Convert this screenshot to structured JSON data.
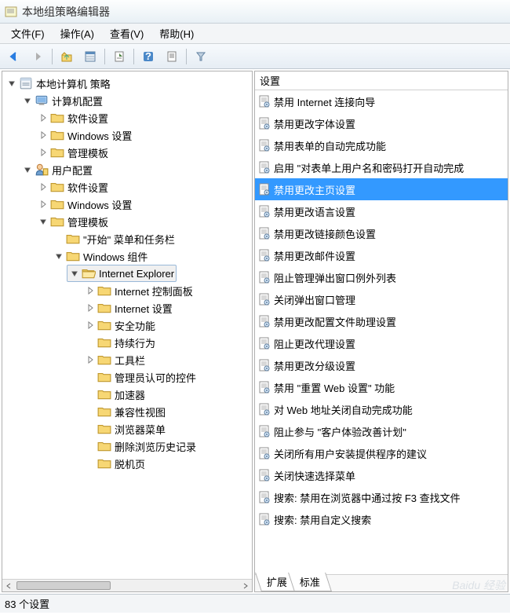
{
  "window": {
    "title": "本地组策略编辑器"
  },
  "menu": [
    {
      "label": "文件(F)"
    },
    {
      "label": "操作(A)"
    },
    {
      "label": "查看(V)"
    },
    {
      "label": "帮助(H)"
    }
  ],
  "toolbar": [
    {
      "name": "back-icon",
      "color": "#2a7de1",
      "disabled": false
    },
    {
      "name": "forward-icon",
      "color": "#a0a0a0",
      "disabled": true
    },
    {
      "name": "sep"
    },
    {
      "name": "up-folder-icon"
    },
    {
      "name": "list-view-icon"
    },
    {
      "name": "sep"
    },
    {
      "name": "export-icon"
    },
    {
      "name": "sep"
    },
    {
      "name": "help-icon"
    },
    {
      "name": "properties-icon"
    },
    {
      "name": "sep"
    },
    {
      "name": "filter-icon"
    }
  ],
  "tree": {
    "root": {
      "icon": "policy",
      "label": "本地计算机 策略",
      "expanded": true,
      "children": [
        {
          "icon": "computer",
          "label": "计算机配置",
          "expanded": true,
          "children": [
            {
              "icon": "folder",
              "label": "软件设置",
              "collapsed": true
            },
            {
              "icon": "folder",
              "label": "Windows 设置",
              "collapsed": true
            },
            {
              "icon": "folder",
              "label": "管理模板",
              "collapsed": true
            }
          ]
        },
        {
          "icon": "user",
          "label": "用户配置",
          "expanded": true,
          "children": [
            {
              "icon": "folder",
              "label": "软件设置",
              "collapsed": true
            },
            {
              "icon": "folder",
              "label": "Windows 设置",
              "collapsed": true
            },
            {
              "icon": "folder",
              "label": "管理模板",
              "expanded": true,
              "children": [
                {
                  "icon": "folder",
                  "label": "\"开始\" 菜单和任务栏",
                  "leaf": true
                },
                {
                  "icon": "folder",
                  "label": "Windows 组件",
                  "expanded": true,
                  "children": [
                    {
                      "icon": "folder-open",
                      "label": "Internet Explorer",
                      "expanded": true,
                      "selected": true,
                      "children": [
                        {
                          "icon": "folder",
                          "label": "Internet 控制面板",
                          "collapsed": true
                        },
                        {
                          "icon": "folder",
                          "label": "Internet 设置",
                          "collapsed": true
                        },
                        {
                          "icon": "folder",
                          "label": "安全功能",
                          "collapsed": true
                        },
                        {
                          "icon": "folder",
                          "label": "持续行为",
                          "leaf": true
                        },
                        {
                          "icon": "folder",
                          "label": "工具栏",
                          "collapsed": true
                        },
                        {
                          "icon": "folder",
                          "label": "管理员认可的控件",
                          "leaf": true
                        },
                        {
                          "icon": "folder",
                          "label": "加速器",
                          "leaf": true
                        },
                        {
                          "icon": "folder",
                          "label": "兼容性视图",
                          "leaf": true
                        },
                        {
                          "icon": "folder",
                          "label": "浏览器菜单",
                          "leaf": true
                        },
                        {
                          "icon": "folder",
                          "label": "删除浏览历史记录",
                          "leaf": true
                        },
                        {
                          "icon": "folder",
                          "label": "脱机页",
                          "leaf": true
                        }
                      ]
                    }
                  ]
                }
              ]
            }
          ]
        }
      ]
    }
  },
  "list": {
    "header": "设置",
    "selected_index": 4,
    "items": [
      "禁用 Internet 连接向导",
      "禁用更改字体设置",
      "禁用表单的自动完成功能",
      "启用 \"对表单上用户名和密码打开自动完成",
      "禁用更改主页设置",
      "禁用更改语言设置",
      "禁用更改链接颜色设置",
      "禁用更改邮件设置",
      "阻止管理弹出窗口例外列表",
      "关闭弹出窗口管理",
      "禁用更改配置文件助理设置",
      "阻止更改代理设置",
      "禁用更改分级设置",
      "禁用 \"重置 Web 设置\" 功能",
      "对 Web 地址关闭自动完成功能",
      "阻止参与 \"客户体验改善计划\"",
      "关闭所有用户安装提供程序的建议",
      "关闭快速选择菜单",
      "搜索: 禁用在浏览器中通过按 F3 查找文件",
      "搜索: 禁用自定义搜索"
    ],
    "tabs": [
      {
        "label": "扩展",
        "active": false
      },
      {
        "label": "标准",
        "active": true
      }
    ]
  },
  "status": {
    "text": "83 个设置"
  }
}
